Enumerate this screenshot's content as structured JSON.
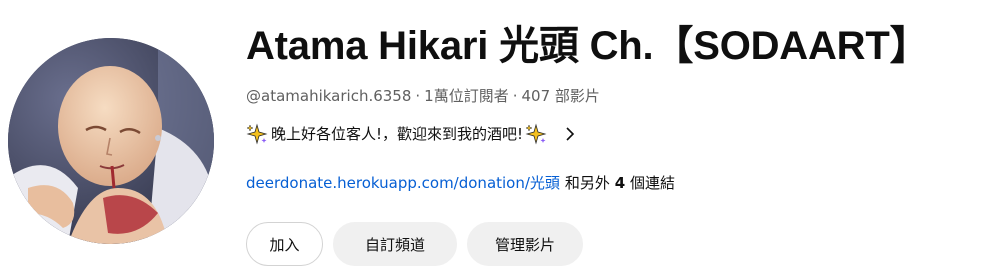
{
  "channel": {
    "title": "Atama Hikari 光頭 Ch.【SODAART】",
    "handle": "@atamahikarich.6358",
    "subscribers": "1萬位訂閱者",
    "videos": "407 部影片",
    "separator": "·"
  },
  "description": {
    "text": "晚上好各位客人!，歡迎來到我的酒吧!",
    "icon_leading": "sparkles-icon",
    "icon_trailing": "sparkles-icon",
    "expand_icon": "chevron-right-icon"
  },
  "links": {
    "primary_link": "deerdonate.herokuapp.com/donation/光頭",
    "more_prefix": "和另外",
    "more_count": "4",
    "more_suffix": "個連結"
  },
  "buttons": {
    "join": "加入",
    "customize": "自訂頻道",
    "manage": "管理影片"
  },
  "colors": {
    "link": "#065fd4",
    "secondary_text": "#606060",
    "button_bg": "#f0f0f0"
  }
}
